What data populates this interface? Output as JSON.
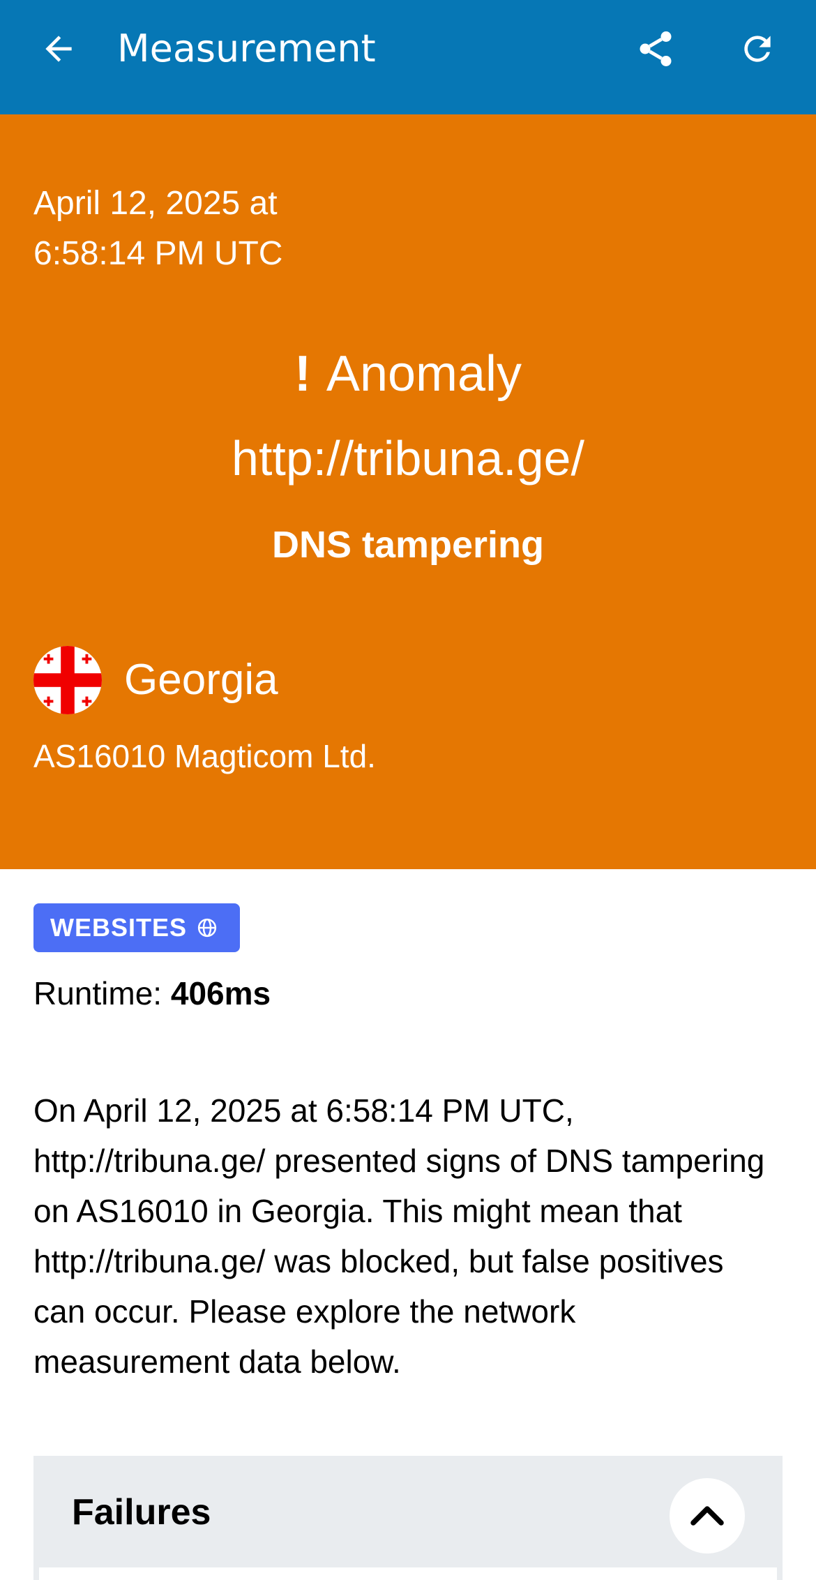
{
  "appbar": {
    "title": "Measurement",
    "back_icon": "arrow-left-icon",
    "share_icon": "share-icon",
    "refresh_icon": "refresh-icon",
    "background_color": "#0677b5"
  },
  "hero": {
    "background_color": "#e57702",
    "date_line1": "April 12, 2025 at",
    "date_line2": "6:58:14 PM UTC",
    "status_mark": "!",
    "status": "Anomaly",
    "url": "http://tribuna.ge/",
    "anomaly_type": "DNS tampering",
    "country_flag_icon": "georgia-flag-icon",
    "country": "Georgia",
    "network": "AS16010 Magticom Ltd."
  },
  "details": {
    "category_badge": "WEBSITES",
    "category_icon": "globe-icon",
    "badge_color": "#4c6ef5",
    "runtime_label": "Runtime: ",
    "runtime_value": "406ms",
    "summary": "On April 12, 2025 at 6:58:14 PM UTC, http://tribuna.ge/ presented signs of DNS tampering on AS16010 in Georgia. This might mean that http://tribuna.ge/ was blocked, but false positives can occur. Please explore the network measurement data below."
  },
  "failures": {
    "title": "Failures",
    "toggle_icon": "chevron-up-icon"
  }
}
